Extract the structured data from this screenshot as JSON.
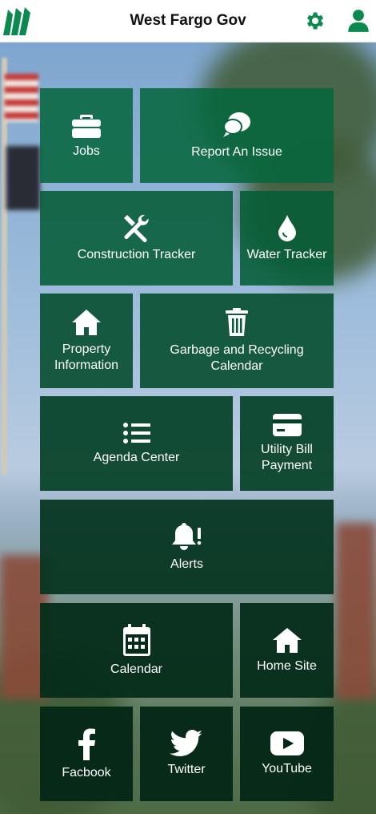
{
  "header": {
    "title": "West Fargo Gov"
  },
  "icons": {
    "logo": "west-fargo-logo",
    "settings": "gear-icon",
    "profile": "user-icon"
  },
  "colors": {
    "brand_green": "#0a8a4e",
    "tile_green": "#06663e"
  },
  "tiles": {
    "jobs": "Jobs",
    "report_issue": "Report An Issue",
    "construction_tracker": "Construction Tracker",
    "water_tracker": "Water Tracker",
    "property_info_line1": "Property",
    "property_info_line2": "Information",
    "garbage_line1": "Garbage and Recycling",
    "garbage_line2": "Calendar",
    "agenda_center": "Agenda Center",
    "utility_line1": "Utility Bill",
    "utility_line2": "Payment",
    "alerts": "Alerts",
    "calendar": "Calendar",
    "home_site": "Home Site",
    "facebook": "Facbook",
    "twitter": "Twitter",
    "youtube": "YouTube"
  }
}
